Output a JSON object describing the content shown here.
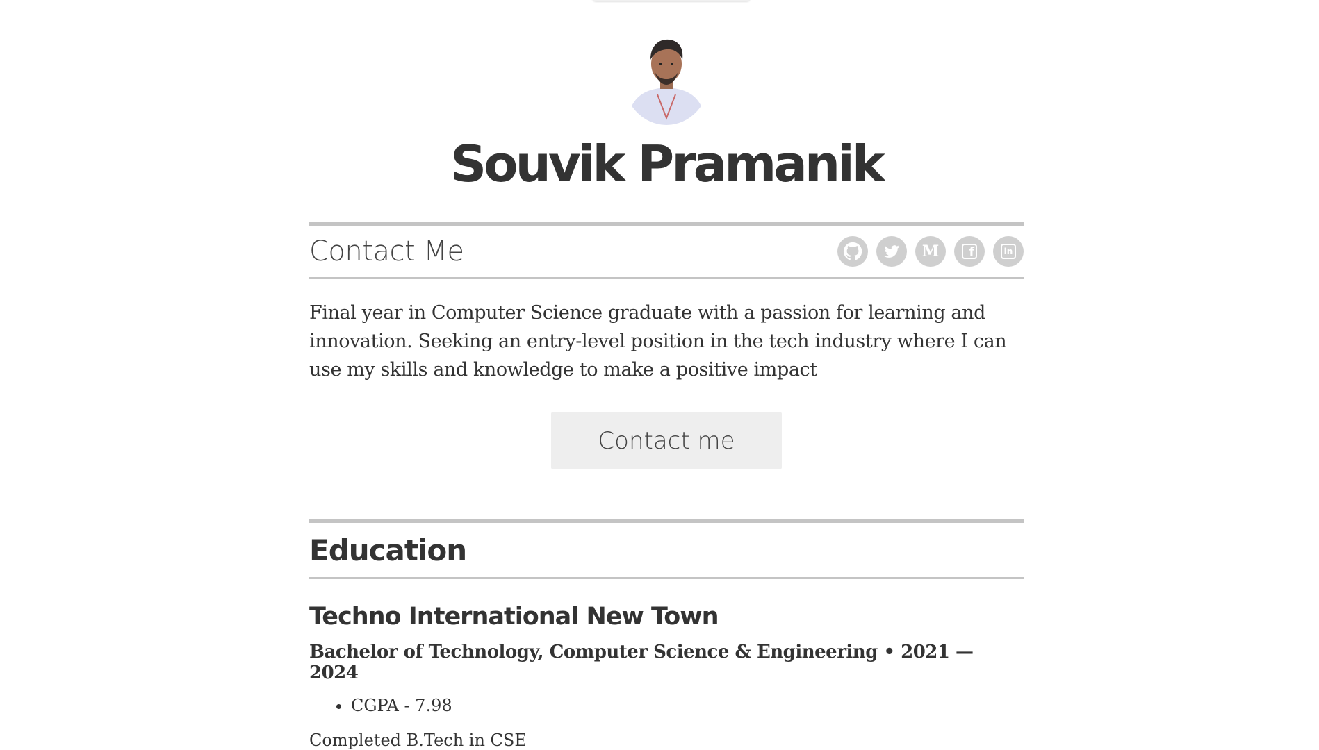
{
  "profile": {
    "name": "Souvik Pramanik"
  },
  "contact": {
    "title": "Contact Me",
    "socials": [
      {
        "icon": "github-icon",
        "label": ""
      },
      {
        "icon": "twitter-icon",
        "label": ""
      },
      {
        "icon": "medium-icon",
        "label": "M"
      },
      {
        "icon": "facebook-icon",
        "label": "f"
      },
      {
        "icon": "linkedin-icon",
        "label": "in"
      }
    ],
    "summary": "Final year in Computer Science graduate with a passion for learning and innovation. Seeking an entry-level position in the tech industry where I can use my skills and knowledge to make a positive impact",
    "button_label": "Contact me"
  },
  "education": {
    "title": "Education",
    "entries": [
      {
        "school": "Techno International New Town",
        "degree": "Bachelor of Technology, Computer Science & Engineering • 2021 — 2024",
        "bullets": [
          "CGPA - 7.98"
        ],
        "note": "Completed B.Tech in CSE"
      }
    ]
  },
  "colors": {
    "text": "#333333",
    "rule": "#c4c4c4",
    "icon_bg": "#cfcfcf",
    "button_bg": "#eeeeee"
  }
}
